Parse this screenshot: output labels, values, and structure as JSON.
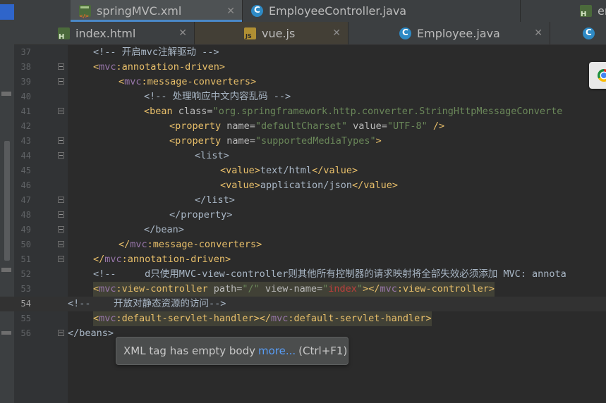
{
  "tabs_row1": [
    {
      "label": "springMVC.xml",
      "icon": "xml-file-icon",
      "active": true
    },
    {
      "label": "EmployeeController.java",
      "icon": "java-class-icon",
      "active": false
    },
    {
      "label": "en",
      "icon": "html-file-icon",
      "active": false
    }
  ],
  "tabs_row2": [
    {
      "label": "index.html",
      "icon": "html-file-icon"
    },
    {
      "label": "vue.js",
      "icon": "js-file-icon"
    },
    {
      "label": "Employee.java",
      "icon": "java-class-icon"
    }
  ],
  "close_glyph": "✕",
  "line_numbers": [
    "37",
    "38",
    "39",
    "40",
    "41",
    "42",
    "43",
    "44",
    "45",
    "46",
    "47",
    "48",
    "49",
    "50",
    "51",
    "52",
    "53",
    "54",
    "55",
    "56"
  ],
  "code": {
    "l37": "<!-- 开启mvc注解驱动 -->",
    "l38_open": "<",
    "l38_ns": "mvc",
    "l38_tag": ":annotation-driven>",
    "l39_open": "<",
    "l39_ns": "mvc",
    "l39_tag": ":message-converters>",
    "l40": "<!-- 处理响应中文内容乱码 -->",
    "l41_tag": "<bean ",
    "l41_attr": "class=",
    "l41_val": "\"org.springframework.http.converter.StringHttpMessageConverte",
    "l42_tag": "<property ",
    "l42_attr1": "name=",
    "l42_val1": "\"defaultCharset\"",
    "l42_attr2": " value=",
    "l42_val2": "\"UTF-8\"",
    "l42_end": " />",
    "l43_tag": "<property ",
    "l43_attr": "name=",
    "l43_val": "\"supportedMediaTypes\"",
    "l43_end": ">",
    "l44": "<list>",
    "l45_open": "<value>",
    "l45_text": "text/html",
    "l45_close": "</value>",
    "l46_open": "<value>",
    "l46_text": "application/json",
    "l46_close": "</value>",
    "l47": "</list>",
    "l48": "</property>",
    "l49": "</bean>",
    "l50_open": "</",
    "l50_ns": "mvc",
    "l50_tag": ":message-converters>",
    "l51_open": "</",
    "l51_ns": "mvc",
    "l51_tag": ":annotation-driven>",
    "l52": "<!--     d只使用MVC-view-controller则其他所有控制器的请求映射将全部失效必须添加 MVC: annota",
    "l53_open": "<",
    "l53_ns": "mvc",
    "l53_tag": ":view-controller ",
    "l53_attr1": "path=",
    "l53_val1": "\"/\"",
    "l53_attr2": " view-name=",
    "l53_q1": "\"",
    "l53_valwarn": "index",
    "l53_q2": "\"",
    "l53_mid": "></",
    "l53_ns2": "mvc",
    "l53_close": ":view-controller>",
    "l54": "<!--    开放对静态资源的访问-->",
    "l55_open": "<",
    "l55_ns": "mvc",
    "l55_tag": ":default-servlet-handler></",
    "l55_ns2": "mvc",
    "l55_close": ":default-servlet-handler>",
    "l56": "</beans>"
  },
  "tooltip": {
    "message": "XML tag has empty body",
    "link": "more...",
    "shortcut": "(Ctrl+F1)"
  },
  "colors": {
    "tag": "#e8bf6a",
    "namespace": "#9876aa",
    "attribute": "#bababa",
    "string": "#6a8759",
    "comment": "#808080",
    "link": "#589df6"
  }
}
